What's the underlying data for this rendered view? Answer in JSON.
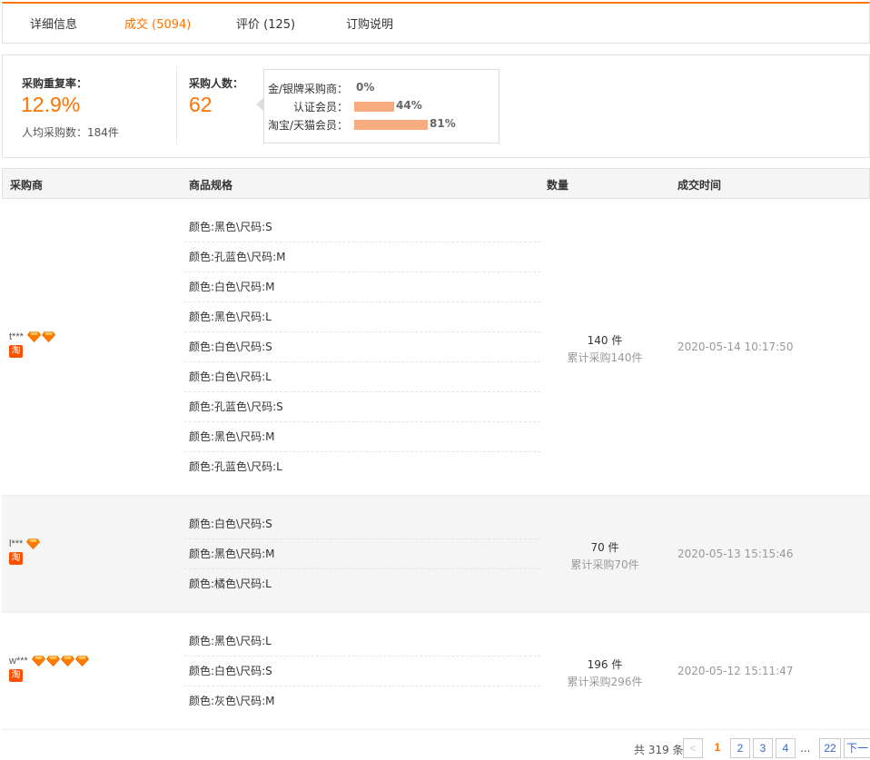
{
  "tabs": [
    {
      "label": "详细信息"
    },
    {
      "label": "成交 (5094)",
      "active": true
    },
    {
      "label": "评价 (125)"
    },
    {
      "label": "订购说明"
    }
  ],
  "stats": {
    "repeat_label": "采购重复率：",
    "repeat_value": "12.9%",
    "avg_text": "人均采购数：184件",
    "buyers_label": "采购人数：",
    "buyers_value": "62",
    "members": [
      {
        "label": "金/银牌采购商：",
        "pct": "0%",
        "fraction": 0
      },
      {
        "label": "认证会员：",
        "pct": "44%",
        "fraction": 0.44
      },
      {
        "label": "淘宝/天猫会员：",
        "pct": "81%",
        "fraction": 0.81
      }
    ],
    "bar_color": "#f9ab80"
  },
  "table": {
    "headers": [
      "采购商",
      "商品规格",
      "数量",
      "成交时间"
    ],
    "rows": [
      {
        "buyer": "t***",
        "gems": 2,
        "badge": "淘",
        "specs": [
          "颜色:黑色\\尺码:S",
          "颜色:孔蓝色\\尺码:M",
          "颜色:白色\\尺码:M",
          "颜色:黑色\\尺码:L",
          "颜色:白色\\尺码:S",
          "颜色:白色\\尺码:L",
          "颜色:孔蓝色\\尺码:S",
          "颜色:黑色\\尺码:M",
          "颜色:孔蓝色\\尺码:L"
        ],
        "qty": "140 件",
        "qty_total": "累计采购140件",
        "time": "2020-05-14 10:17:50"
      },
      {
        "buyer": "l***",
        "gems": 1,
        "badge": "淘",
        "specs": [
          "颜色:白色\\尺码:S",
          "颜色:黑色\\尺码:M",
          "颜色:橘色\\尺码:L"
        ],
        "qty": "70 件",
        "qty_total": "累计采购70件",
        "time": "2020-05-13 15:15:46"
      },
      {
        "buyer": "w***",
        "gems": 4,
        "badge": "淘",
        "specs": [
          "颜色:黑色\\尺码:L",
          "颜色:白色\\尺码:S",
          "颜色:灰色\\尺码:M"
        ],
        "qty": "196 件",
        "qty_total": "累计采购296件",
        "time": "2020-05-12 15:11:47"
      }
    ]
  },
  "pagination": {
    "total": "共 319 条",
    "pages": [
      "1",
      "2",
      "3",
      "4"
    ],
    "ellipsis": "...",
    "last": "22",
    "next": "下一",
    "prev": "<",
    "current": "1"
  },
  "colors": {
    "accent": "#ff7300",
    "badge": "#ff5000",
    "gem": "#ff8a00"
  }
}
